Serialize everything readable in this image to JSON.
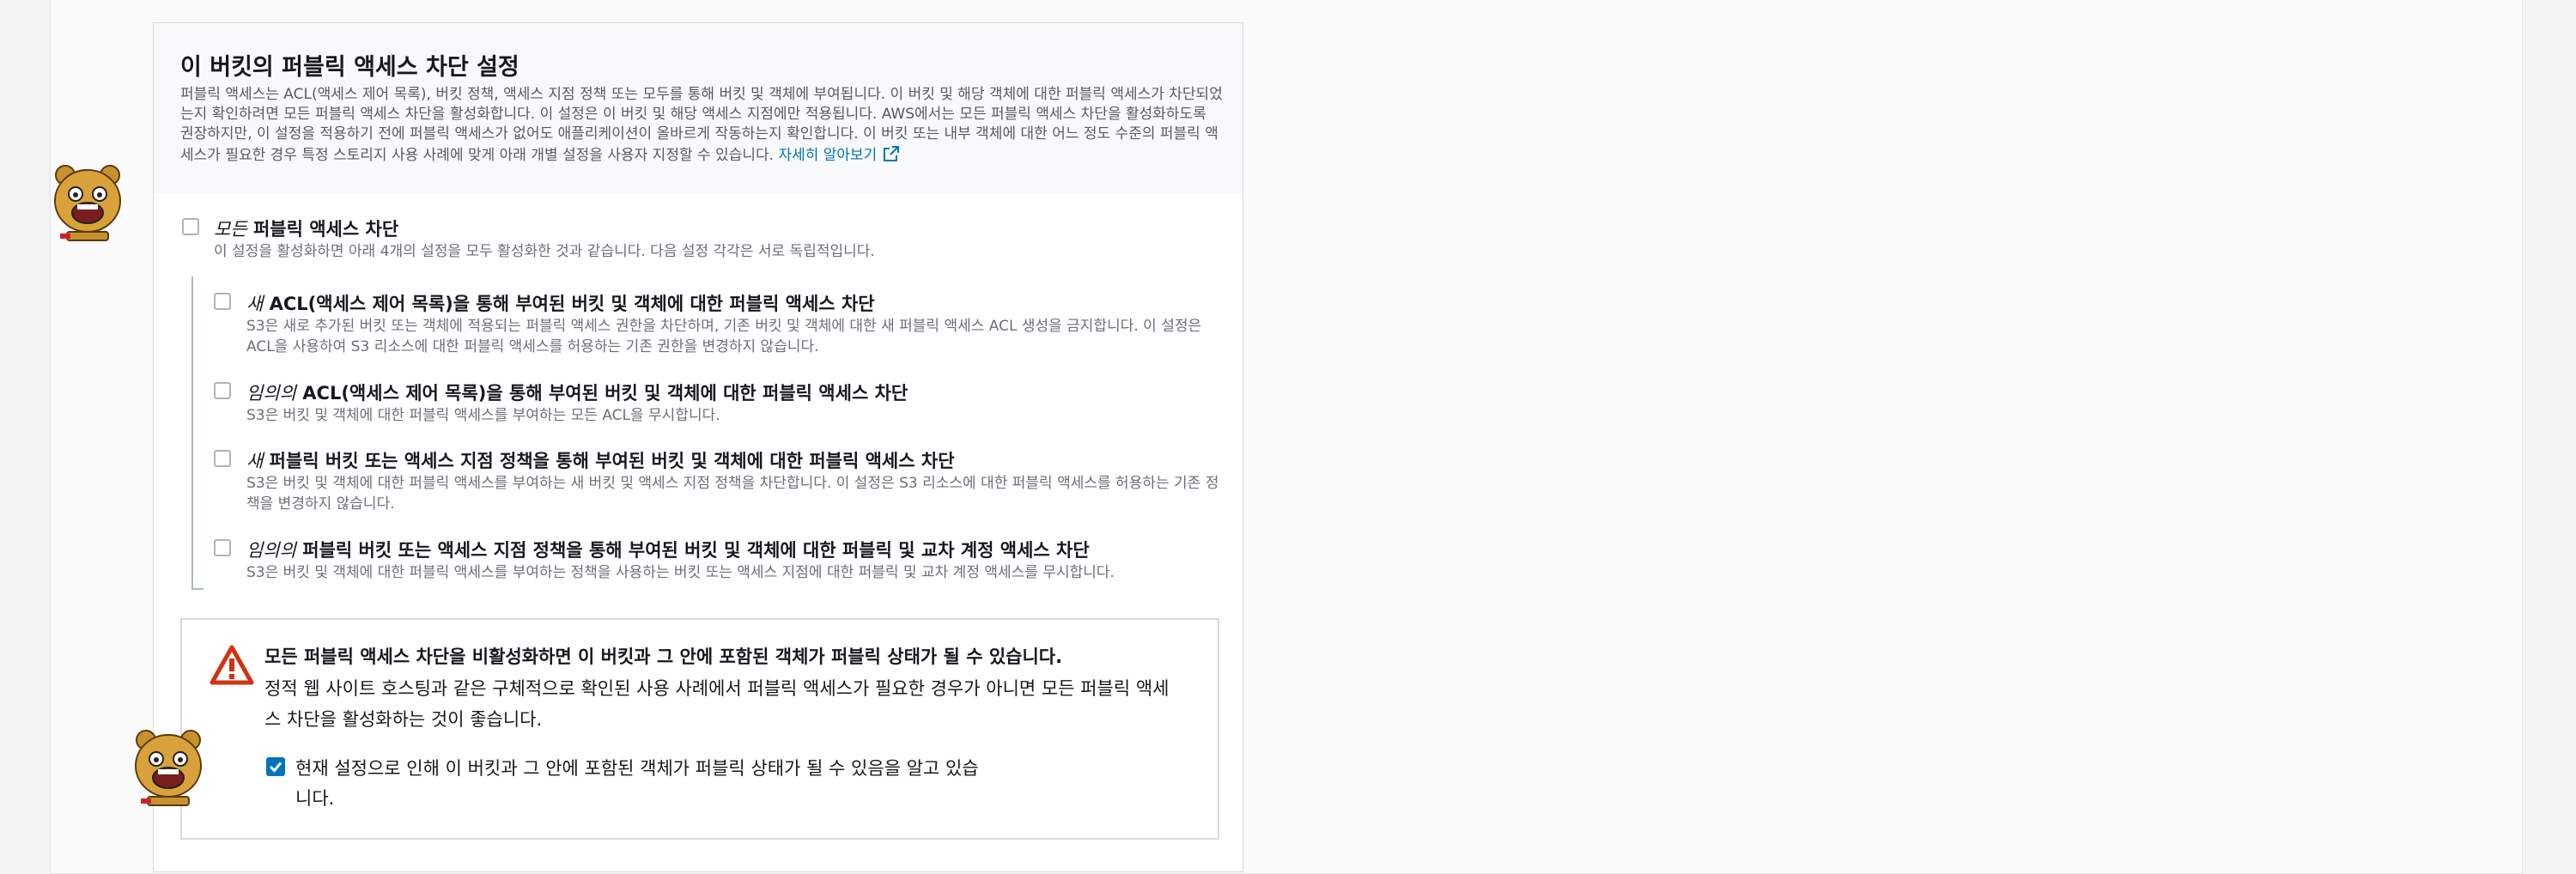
{
  "section": {
    "title": "이 버킷의 퍼블릭 액세스 차단 설정",
    "description": "퍼블릭 액세스는 ACL(액세스 제어 목록), 버킷 정책, 액세스 지점 정책 또는 모두를 통해 버킷 및 객체에 부여됩니다. 이 버킷 및 해당 객체에 대한 퍼블릭 액세스가 차단되었는지 확인하려면 모든 퍼블릭 액세스 차단을 활성화합니다. 이 설정은 이 버킷 및 해당 액세스 지점에만 적용됩니다. AWS에서는 모든 퍼블릭 액세스 차단을 활성화하도록 권장하지만, 이 설정을 적용하기 전에 퍼블릭 액세스가 없어도 애플리케이션이 올바르게 작동하는지 확인합니다. 이 버킷 또는 내부 객체에 대한 어느 정도 수준의 퍼블릭 액세스가 필요한 경우 특정 스토리지 사용 사례에 맞게 아래 개별 설정을 사용자 지정할 수 있습니다.",
    "learn_more": "자세히 알아보기"
  },
  "block_all": {
    "title_em": "모든",
    "title_rest": " 퍼블릭 액세스 차단",
    "description": "이 설정을 활성화하면 아래 4개의 설정을 모두 활성화한 것과 같습니다. 다음 설정 각각은 서로 독립적입니다.",
    "checked": false
  },
  "options": [
    {
      "title_em": "새",
      "title_rest": " ACL(액세스 제어 목록)을 통해 부여된 버킷 및 객체에 대한 퍼블릭 액세스 차단",
      "description": "S3은 새로 추가된 버킷 또는 객체에 적용되는 퍼블릭 액세스 권한을 차단하며, 기존 버킷 및 객체에 대한 새 퍼블릭 액세스 ACL 생성을 금지합니다. 이 설정은 ACL을 사용하여 S3 리소스에 대한 퍼블릭 액세스를 허용하는 기존 권한을 변경하지 않습니다.",
      "checked": false
    },
    {
      "title_em": "임의의",
      "title_rest": " ACL(액세스 제어 목록)을 통해 부여된 버킷 및 객체에 대한 퍼블릭 액세스 차단",
      "description": "S3은 버킷 및 객체에 대한 퍼블릭 액세스를 부여하는 모든 ACL을 무시합니다.",
      "checked": false
    },
    {
      "title_em": "새",
      "title_rest": " 퍼블릭 버킷 또는 액세스 지점 정책을 통해 부여된 버킷 및 객체에 대한 퍼블릭 액세스 차단",
      "description": "S3은 버킷 및 객체에 대한 퍼블릭 액세스를 부여하는 새 버킷 및 액세스 지점 정책을 차단합니다. 이 설정은 S3 리소스에 대한 퍼블릭 액세스를 허용하는 기존 정책을 변경하지 않습니다.",
      "checked": false
    },
    {
      "title_em": "임의의",
      "title_rest": " 퍼블릭 버킷 또는 액세스 지점 정책을 통해 부여된 버킷 및 객체에 대한 퍼블릭 및 교차 계정 액세스 차단",
      "description": "S3은 버킷 및 객체에 대한 퍼블릭 액세스를 부여하는 정책을 사용하는 버킷 또는 액세스 지점에 대한 퍼블릭 및 교차 계정 액세스를 무시합니다.",
      "checked": false
    }
  ],
  "alert": {
    "title": "모든 퍼블릭 액세스 차단을 비활성화하면 이 버킷과 그 안에 포함된 객체가 퍼블릭 상태가 될 수 있습니다.",
    "body": "정적 웹 사이트 호스팅과 같은 구체적으로 확인된 사용 사례에서 퍼블릭 액세스가 필요한 경우가 아니면 모든 퍼블릭 액세스 차단을 활성화하는 것이 좋습니다.",
    "acknowledge": "현재 설정으로 인해 이 버킷과 그 안에 포함된 객체가 퍼블릭 상태가 될 수 있음을 알고 있습니다.",
    "acknowledged": true
  },
  "colors": {
    "link": "#0073bb",
    "warning": "#d13212",
    "checkbox_checked": "#0073bb"
  },
  "icons": [
    "external-link-icon",
    "warning-icon",
    "checkmark-icon",
    "bear-sticker"
  ]
}
